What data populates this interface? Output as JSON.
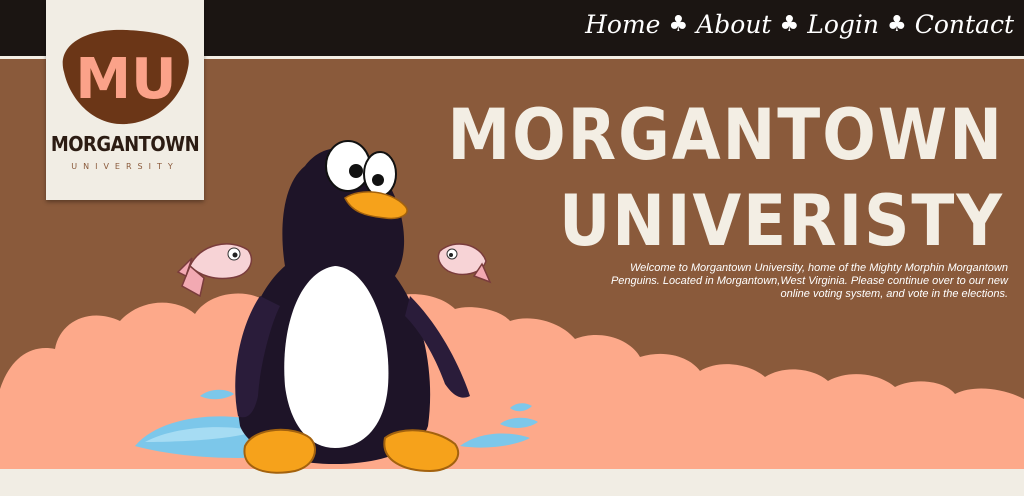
{
  "nav": {
    "home": "Home",
    "about": "About",
    "login": "Login",
    "contact": "Contact",
    "separator": "♣"
  },
  "logo": {
    "mark": "MU",
    "name": "MORGANTOWN",
    "subtitle": "UNIVERSITY"
  },
  "hero": {
    "title_line1": "MORGANTOWN",
    "title_line2": "UNIVERISTY",
    "description": "Welcome to Morgantown University, home of the Mighty Morphin Morgantown Penguins. Located in Morgantown,West Virginia. Please continue over to our new online voting system, and vote in the elections."
  },
  "colors": {
    "topbar": "#1b1512",
    "brown": "#8a5a3b",
    "cream": "#f1ede4",
    "cloud": "#fda98a",
    "logo_blob": "#6b3617",
    "logo_letters": "#fba289"
  }
}
